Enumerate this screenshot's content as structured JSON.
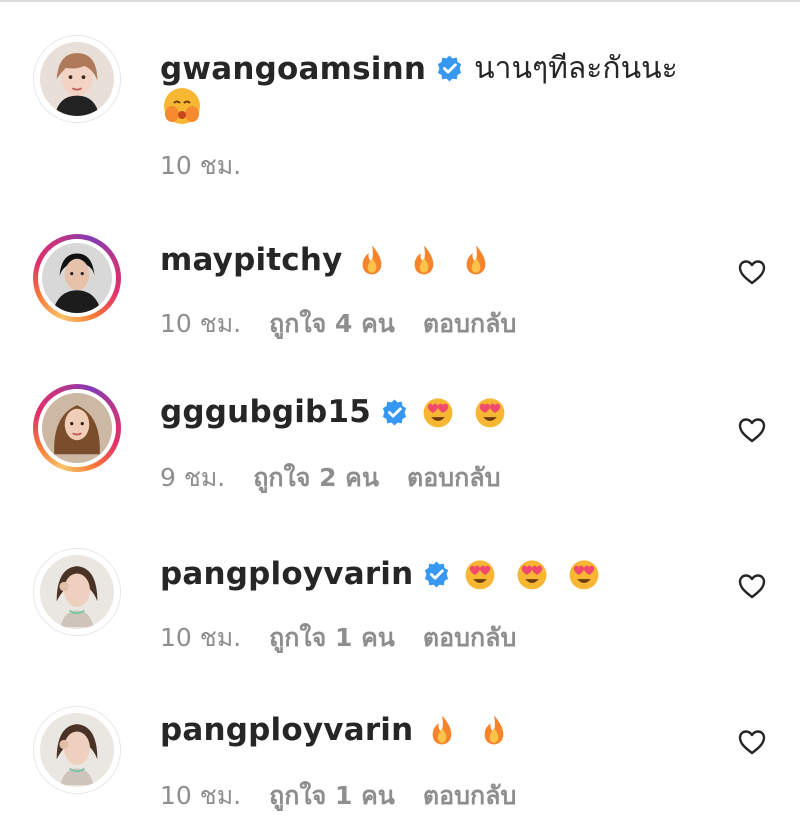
{
  "comments": [
    {
      "username": "gwangoamsinn",
      "verified": true,
      "text": "นานๆทีละกันนะ",
      "emoji": "blushing-hands-face",
      "time": "10 ชม.",
      "likes": "",
      "reply": ""
    },
    {
      "username": "maypitchy",
      "verified": false,
      "text": "",
      "emoji": "fire",
      "emoji_count": 3,
      "time": "10 ชม.",
      "likes": "ถูกใจ 4 คน",
      "reply": "ตอบกลับ"
    },
    {
      "username": "gggubgib15",
      "verified": true,
      "text": "",
      "emoji": "heart-eyes",
      "emoji_count": 2,
      "time": "9 ชม.",
      "likes": "ถูกใจ 2 คน",
      "reply": "ตอบกลับ"
    },
    {
      "username": "pangployvarin",
      "verified": true,
      "text": "",
      "emoji": "heart-eyes",
      "emoji_count": 3,
      "time": "10 ชม.",
      "likes": "ถูกใจ 1 คน",
      "reply": "ตอบกลับ"
    },
    {
      "username": "pangployvarin",
      "verified": false,
      "text": "",
      "emoji": "fire",
      "emoji_count": 2,
      "time": "10 ชม.",
      "likes": "ถูกใจ 1 คน",
      "reply": "ตอบกลับ"
    }
  ],
  "colors": {
    "verified": "#3897f0",
    "meta_text": "#8e8e8e",
    "username": "#262626",
    "fire": "#f7842b",
    "heart_eye_face": "#f7b733",
    "heart": "#f14a6c"
  },
  "icons": {
    "verified": "verified-badge-icon",
    "like": "heart-outline-icon"
  }
}
